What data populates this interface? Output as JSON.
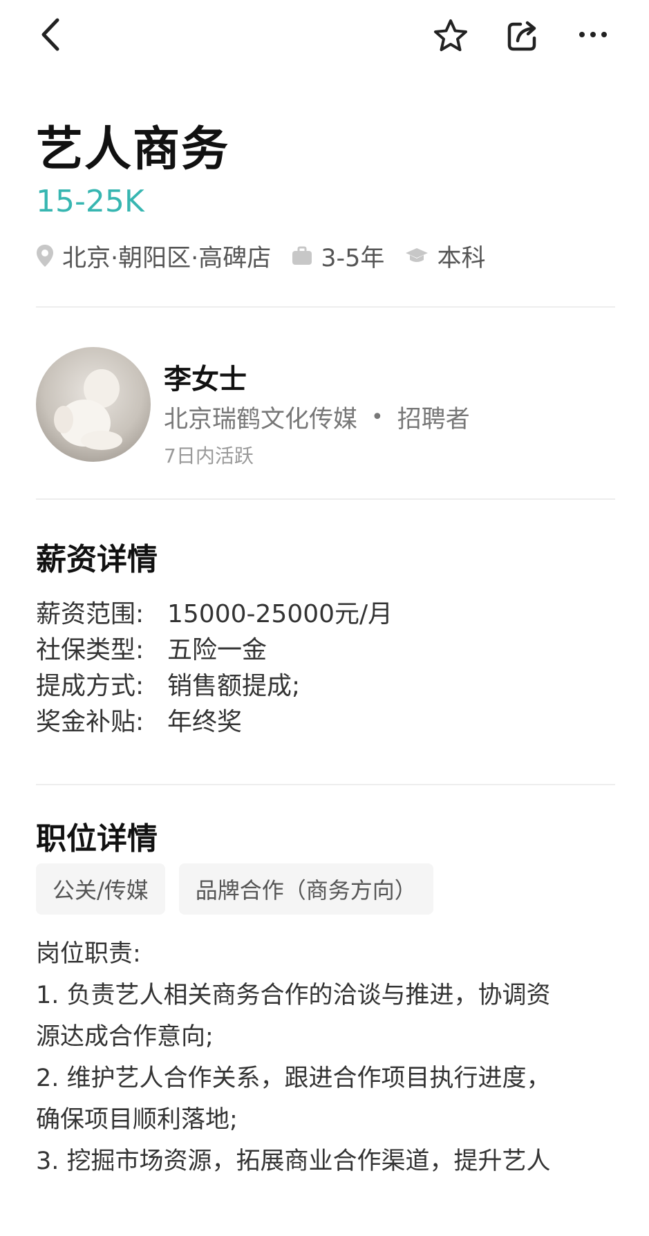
{
  "nav": {
    "back_icon": "chevron-left-icon",
    "favorite_icon": "star-icon",
    "share_icon": "share-icon",
    "more_icon": "more-icon"
  },
  "job": {
    "title": "艺人商务",
    "salary": "15-25K",
    "location": "北京·朝阳区·高碑店",
    "experience": "3-5年",
    "education": "本科",
    "accent_color": "#37b6b1"
  },
  "recruiter": {
    "name": "李女士",
    "company": "北京瑞鹤文化传媒",
    "separator": "•",
    "role": "招聘者",
    "activity": "7日内活跃"
  },
  "salary_details": {
    "heading": "薪资详情",
    "rows": [
      {
        "label": "薪资范围:",
        "value": "15000-25000元/月"
      },
      {
        "label": "社保类型:",
        "value": "五险一金"
      },
      {
        "label": "提成方式:",
        "value": "销售额提成;"
      },
      {
        "label": "奖金补贴:",
        "value": "年终奖"
      }
    ]
  },
  "position_details": {
    "heading": "职位详情",
    "tags": [
      "公关/传媒",
      "品牌合作（商务方向）"
    ],
    "lines": [
      "岗位职责:",
      "1. 负责艺人相关商务合作的洽谈与推进，协调资",
      "源达成合作意向;",
      "2. 维护艺人合作关系，跟进合作项目执行进度，",
      "确保项目顺利落地;",
      "3. 挖掘市场资源，拓展商业合作渠道，提升艺人"
    ]
  }
}
